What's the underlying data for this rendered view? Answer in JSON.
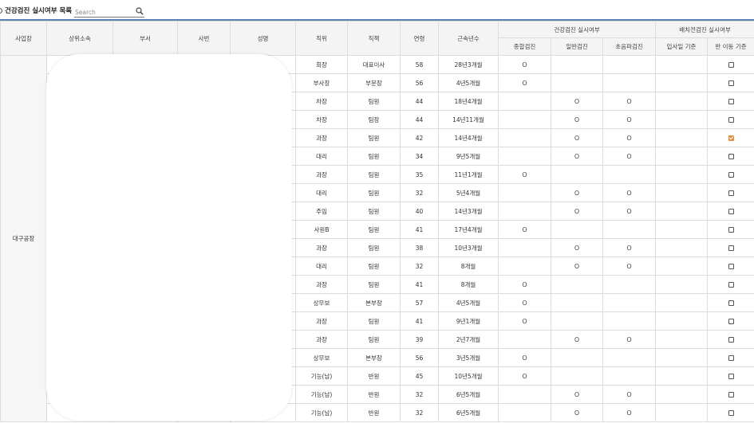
{
  "header": {
    "title": "건강검진 실시여부 목록",
    "search_placeholder": "Search"
  },
  "columns": {
    "site": "사업장",
    "parent_dept": "상위소속",
    "dept": "부서",
    "emp_no": "사번",
    "name": "성명",
    "position": "직위",
    "duty": "직책",
    "age": "연령",
    "tenure": "근속년수",
    "health_group": "건강검진 실시여부",
    "comprehensive": "종합검진",
    "general": "일반검진",
    "noise": "초음파검진",
    "placement_group": "배치전검진 실시여부",
    "hire_basis": "입사일 기준",
    "transfer_basis": "반 이동 기준"
  },
  "site_value": "대구공장",
  "mark_symbol": "O",
  "rows": [
    {
      "position": "회장",
      "duty": "대표이사",
      "age": "58",
      "tenure": "28년3개월",
      "comprehensive": true,
      "general": false,
      "noise": false,
      "transfer_checked": false
    },
    {
      "position": "부사장",
      "duty": "부문장",
      "age": "56",
      "tenure": "4년5개월",
      "comprehensive": true,
      "general": false,
      "noise": false,
      "transfer_checked": false
    },
    {
      "position": "차장",
      "duty": "팀원",
      "age": "44",
      "tenure": "18년4개월",
      "comprehensive": false,
      "general": true,
      "noise": true,
      "transfer_checked": false
    },
    {
      "position": "차장",
      "duty": "팀장",
      "age": "44",
      "tenure": "14년11개월",
      "comprehensive": false,
      "general": true,
      "noise": true,
      "transfer_checked": false
    },
    {
      "position": "과장",
      "duty": "팀원",
      "age": "42",
      "tenure": "14년4개월",
      "comprehensive": false,
      "general": true,
      "noise": true,
      "transfer_checked": true
    },
    {
      "position": "대리",
      "duty": "팀원",
      "age": "34",
      "tenure": "9년5개월",
      "comprehensive": false,
      "general": true,
      "noise": true,
      "transfer_checked": false
    },
    {
      "position": "과장",
      "duty": "팀원",
      "age": "35",
      "tenure": "11년1개월",
      "comprehensive": true,
      "general": false,
      "noise": false,
      "transfer_checked": false
    },
    {
      "position": "대리",
      "duty": "팀원",
      "age": "32",
      "tenure": "5년4개월",
      "comprehensive": false,
      "general": true,
      "noise": true,
      "transfer_checked": false
    },
    {
      "position": "주임",
      "duty": "팀원",
      "age": "40",
      "tenure": "14년3개월",
      "comprehensive": false,
      "general": true,
      "noise": true,
      "transfer_checked": false
    },
    {
      "position": "사원B",
      "duty": "팀원",
      "age": "41",
      "tenure": "17년4개월",
      "comprehensive": true,
      "general": false,
      "noise": false,
      "transfer_checked": false
    },
    {
      "position": "과장",
      "duty": "팀원",
      "age": "38",
      "tenure": "10년3개월",
      "comprehensive": false,
      "general": true,
      "noise": true,
      "transfer_checked": false
    },
    {
      "position": "대리",
      "duty": "팀원",
      "age": "32",
      "tenure": "8개월",
      "comprehensive": false,
      "general": true,
      "noise": true,
      "transfer_checked": false
    },
    {
      "position": "과장",
      "duty": "팀원",
      "age": "41",
      "tenure": "8개월",
      "comprehensive": true,
      "general": false,
      "noise": false,
      "transfer_checked": false
    },
    {
      "position": "상무보",
      "duty": "본부장",
      "age": "57",
      "tenure": "4년5개월",
      "comprehensive": true,
      "general": false,
      "noise": false,
      "transfer_checked": false
    },
    {
      "position": "과장",
      "duty": "팀원",
      "age": "41",
      "tenure": "9년1개월",
      "comprehensive": true,
      "general": false,
      "noise": false,
      "transfer_checked": false
    },
    {
      "position": "과장",
      "duty": "팀원",
      "age": "39",
      "tenure": "2년7개월",
      "comprehensive": false,
      "general": true,
      "noise": true,
      "transfer_checked": false
    },
    {
      "position": "상무보",
      "duty": "본부장",
      "age": "56",
      "tenure": "3년5개월",
      "comprehensive": true,
      "general": false,
      "noise": false,
      "transfer_checked": false
    },
    {
      "position": "기능(남)",
      "duty": "반원",
      "age": "45",
      "tenure": "10년5개월",
      "comprehensive": true,
      "general": false,
      "noise": false,
      "transfer_checked": false
    },
    {
      "position": "기능(남)",
      "duty": "반원",
      "age": "32",
      "tenure": "6년5개월",
      "comprehensive": false,
      "general": true,
      "noise": true,
      "transfer_checked": false
    },
    {
      "position": "기능(남)",
      "duty": "반원",
      "age": "32",
      "tenure": "6년5개월",
      "comprehensive": false,
      "general": true,
      "noise": true,
      "transfer_checked": false
    }
  ],
  "colors": {
    "header_bg": "#f4f4f4",
    "border": "#dcdcdc",
    "accent_line": "#5b7fb0",
    "checkbox_checked": "#e8943a"
  }
}
